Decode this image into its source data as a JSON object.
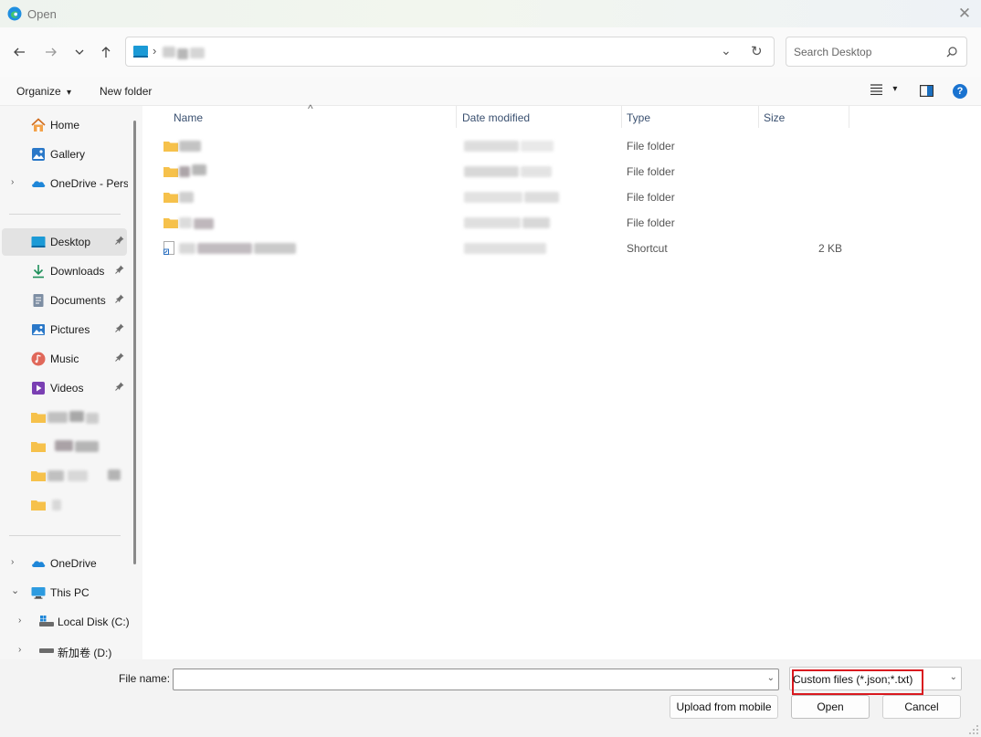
{
  "window": {
    "title": "Open",
    "close_glyph": "✕"
  },
  "nav": {
    "back_glyph": "←",
    "forward_glyph": "→",
    "recent_glyph": "⌄",
    "up_glyph": "↑",
    "breadcrumb_separator": "›",
    "refresh_glyph": "↻",
    "address_dropdown_glyph": "⌄",
    "search_placeholder": "Search Desktop"
  },
  "commands": {
    "organize": "Organize",
    "organize_caret": "▾",
    "new_folder": "New folder",
    "view_caret": "▾",
    "help": "?"
  },
  "sidebar": {
    "items": [
      {
        "label": "Home",
        "icon": "home-icon"
      },
      {
        "label": "Gallery",
        "icon": "gallery-icon"
      },
      {
        "label": "OneDrive - Perso",
        "icon": "onedrive-icon",
        "chevron": "›"
      },
      {
        "label": "Desktop",
        "icon": "desktop-icon",
        "pinned": true,
        "selected": true
      },
      {
        "label": "Downloads",
        "icon": "downloads-icon",
        "pinned": true
      },
      {
        "label": "Documents",
        "icon": "documents-icon",
        "pinned": true
      },
      {
        "label": "Pictures",
        "icon": "pictures-icon",
        "pinned": true
      },
      {
        "label": "Music",
        "icon": "music-icon",
        "pinned": true
      },
      {
        "label": "Videos",
        "icon": "videos-icon",
        "pinned": true
      },
      {
        "label": "OneDrive",
        "icon": "onedrive-icon",
        "chevron": "›"
      },
      {
        "label": "This PC",
        "icon": "pc-icon",
        "chevron": "⌄"
      },
      {
        "label": "Local Disk (C:)",
        "icon": "drive-icon",
        "chevron": "›"
      },
      {
        "label": "新加卷 (D:)",
        "icon": "drive-icon",
        "chevron": "›"
      }
    ],
    "pin_glyph": "📌"
  },
  "columns": {
    "name": "Name",
    "date": "Date modified",
    "type": "Type",
    "size": "Size",
    "sort_glyph": "^"
  },
  "files": [
    {
      "type": "File folder",
      "size": ""
    },
    {
      "type": "File folder",
      "size": ""
    },
    {
      "type": "File folder",
      "size": ""
    },
    {
      "type": "File folder",
      "size": ""
    },
    {
      "type": "Shortcut",
      "size": "2 KB"
    }
  ],
  "footer": {
    "file_name_label": "File name:",
    "file_name_value": "",
    "dropdown_glyph": "⌄",
    "filter_value": "Custom files (*.json;*.txt)",
    "upload_label": "Upload from mobile",
    "open_label": "Open",
    "cancel_label": "Cancel"
  },
  "colors": {
    "accent": "#0067c0",
    "highlight_border": "#d9191f",
    "folder": "#f6c14b"
  }
}
